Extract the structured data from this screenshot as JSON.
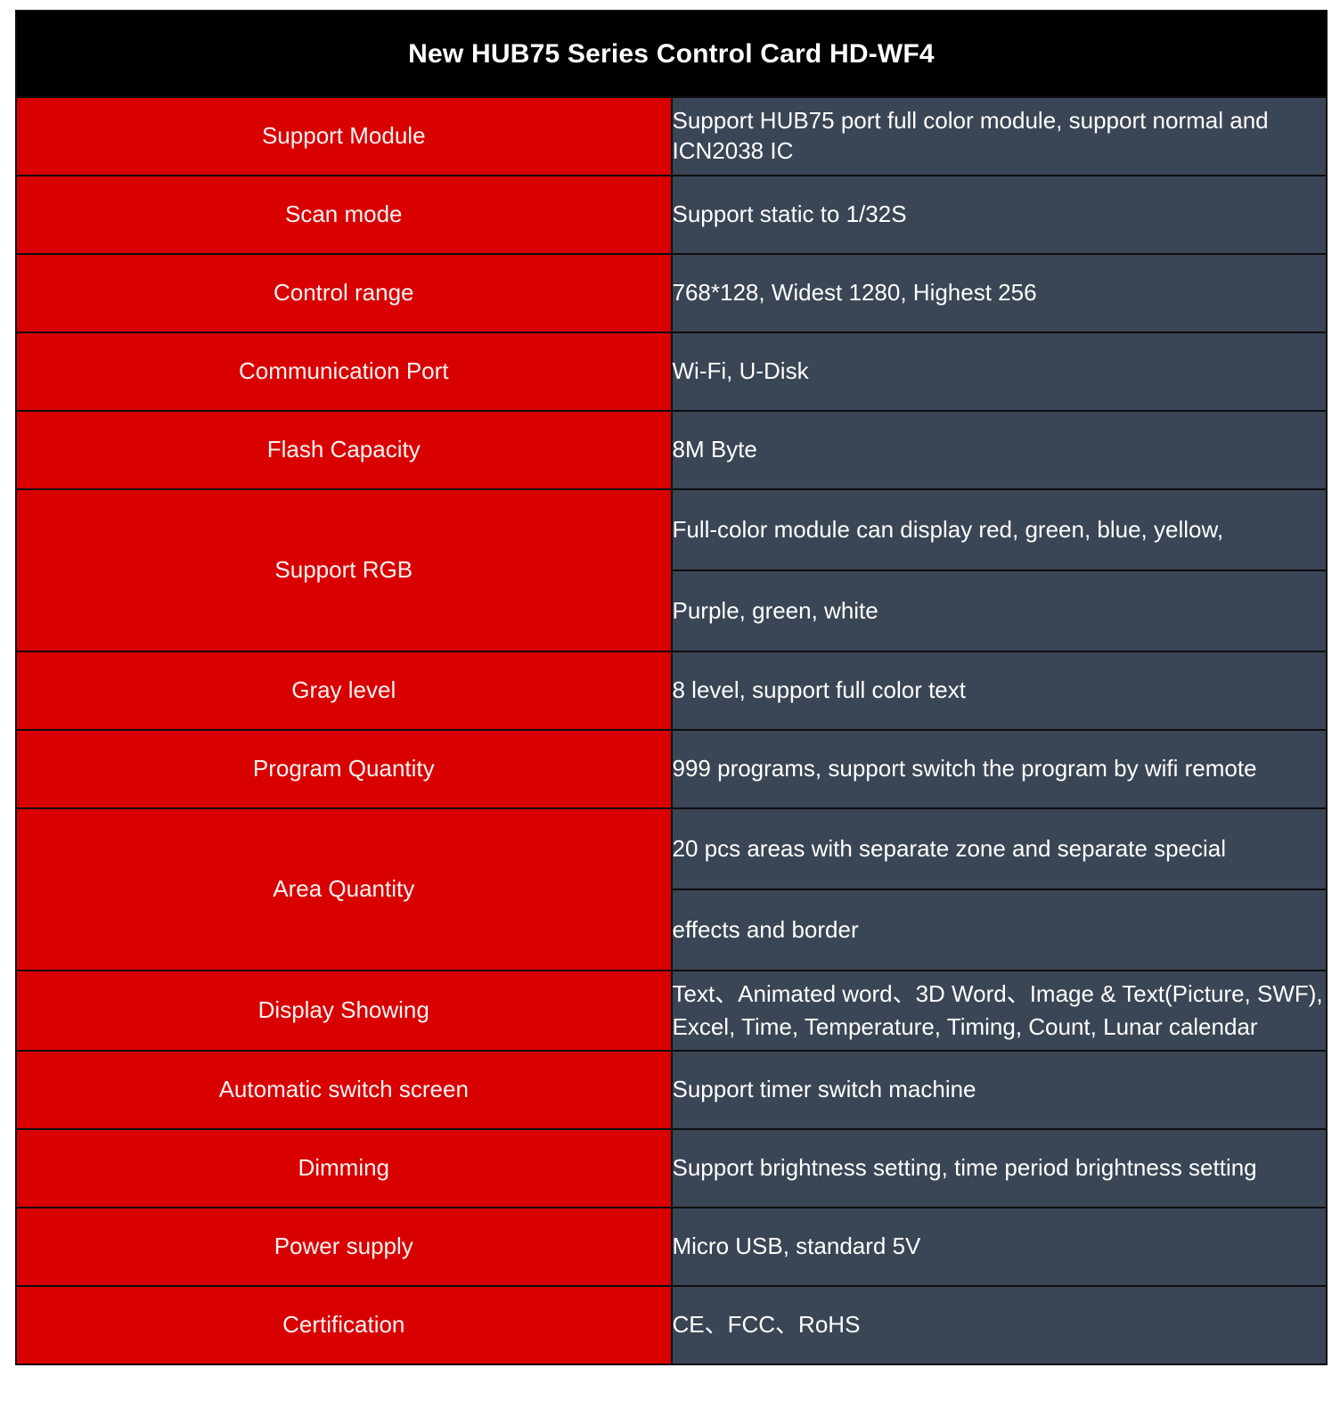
{
  "colors": {
    "label_bg": "#d80000",
    "value_bg": "#3a4555",
    "title_bg": "#000000",
    "border": "#0d0d12",
    "text": "#ffffff"
  },
  "title": "New HUB75 Series Control Card HD-WF4",
  "rows": [
    {
      "label": "Support Module",
      "values": [
        "Support HUB75 port full color module, support normal and ICN2038 IC"
      ]
    },
    {
      "label": "Scan mode",
      "values": [
        "Support static to 1/32S"
      ]
    },
    {
      "label": "Control range",
      "values": [
        "768*128, Widest 1280, Highest 256"
      ]
    },
    {
      "label": "Communication Port",
      "values": [
        "Wi-Fi, U-Disk"
      ]
    },
    {
      "label": "Flash Capacity",
      "values": [
        "8M Byte"
      ]
    },
    {
      "label": "Support RGB",
      "values": [
        "Full-color module can display red, green, blue, yellow,",
        "Purple, green, white"
      ]
    },
    {
      "label": "Gray level",
      "values": [
        "8 level,  support full color text"
      ]
    },
    {
      "label": "Program Quantity",
      "values": [
        "999 programs, support switch the program by wifi remote"
      ]
    },
    {
      "label": "Area Quantity",
      "values": [
        "20 pcs areas with separate zone and separate special",
        "effects and border"
      ]
    },
    {
      "label": "Display Showing",
      "values": [
        "Text、Animated word、3D Word、Image & Text(Picture, SWF), Excel, Time, Temperature, Timing, Count, Lunar calendar"
      ]
    },
    {
      "label": "Automatic switch screen",
      "values": [
        "Support timer switch machine"
      ]
    },
    {
      "label": "Dimming",
      "values": [
        "Support brightness setting, time period brightness setting"
      ]
    },
    {
      "label": "Power supply",
      "values": [
        "Micro USB, standard 5V"
      ]
    },
    {
      "label": "Certification",
      "values": [
        "CE、FCC、RoHS"
      ]
    }
  ]
}
